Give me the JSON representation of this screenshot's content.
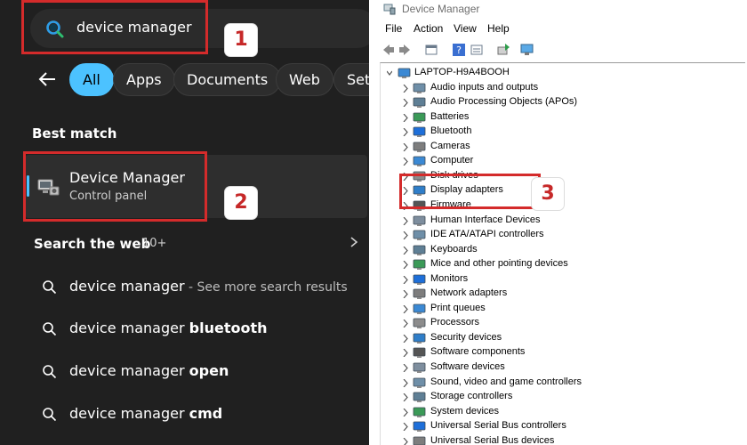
{
  "search_panel": {
    "query": "device manager",
    "filters": [
      "All",
      "Apps",
      "Documents",
      "Web",
      "Sett"
    ],
    "active_filter": "All",
    "best_match_heading": "Best match",
    "best_match": {
      "title": "Device Manager",
      "subtitle": "Control panel"
    },
    "web_heading": "Search the web",
    "web_count": "10+",
    "web_results": [
      {
        "prefix": "device manager",
        "bold": "",
        "suffix": " - See more search results"
      },
      {
        "prefix": "device manager ",
        "bold": "bluetooth",
        "suffix": ""
      },
      {
        "prefix": "device manager ",
        "bold": "open",
        "suffix": ""
      },
      {
        "prefix": "device manager ",
        "bold": "cmd",
        "suffix": ""
      }
    ],
    "icons": [
      "back-arrow-icon",
      "search-icon",
      "device-manager-icon",
      "chevron-right-icon",
      "magnifier-icon"
    ]
  },
  "annotations": {
    "step_1": "1",
    "step_2": "2",
    "step_3": "3",
    "color": "#d42b2b"
  },
  "device_manager": {
    "window_title": "Device Manager",
    "menu": [
      "File",
      "Action",
      "View",
      "Help"
    ],
    "toolbar_icons": [
      "back-icon",
      "forward-icon",
      "properties-icon",
      "help-icon",
      "view-icon",
      "update-driver-icon",
      "scan-hardware-icon"
    ],
    "root": "LAPTOP-H9A4BOOH",
    "categories": [
      "Audio inputs and outputs",
      "Audio Processing Objects (APOs)",
      "Batteries",
      "Bluetooth",
      "Cameras",
      "Computer",
      "Disk drives",
      "Display adapters",
      "Firmware",
      "Human Interface Devices",
      "IDE ATA/ATAPI controllers",
      "Keyboards",
      "Mice and other pointing devices",
      "Monitors",
      "Network adapters",
      "Print queues",
      "Processors",
      "Security devices",
      "Software components",
      "Software devices",
      "Sound, video and game controllers",
      "Storage controllers",
      "System devices",
      "Universal Serial Bus controllers",
      "Universal Serial Bus devices"
    ],
    "highlighted_category": "Display adapters"
  },
  "colors": {
    "accent": "#4cc2ff",
    "panel_bg": "#202020",
    "highlight": "#d42b2b"
  }
}
